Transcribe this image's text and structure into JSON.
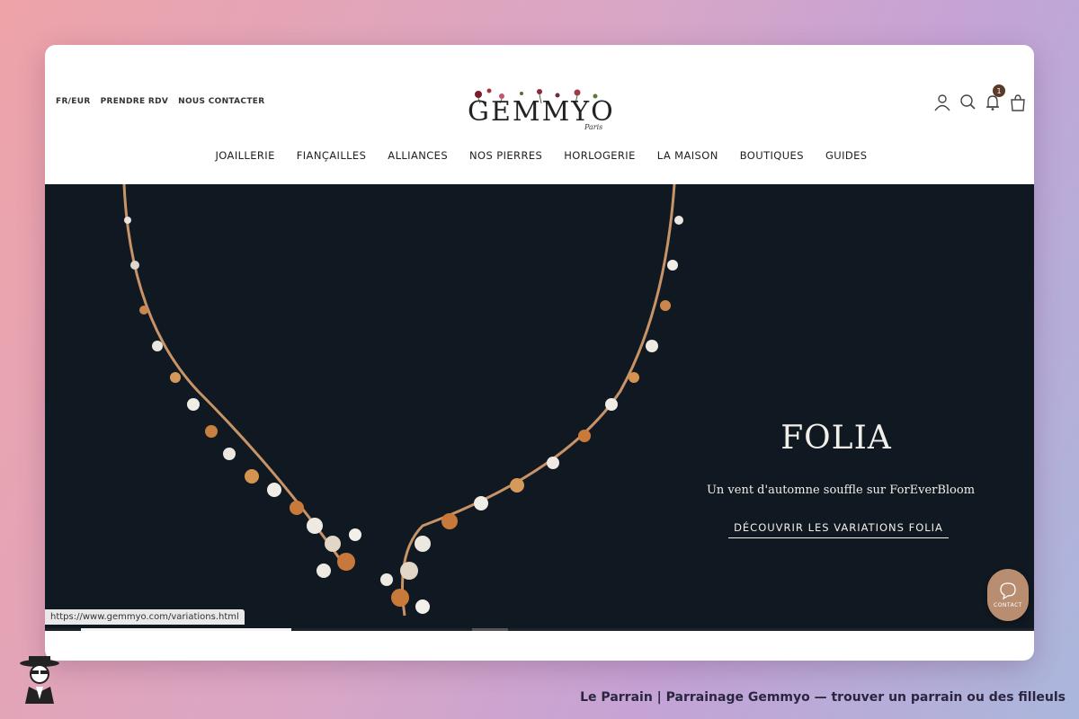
{
  "header": {
    "utility_links": [
      "FR/EUR",
      "PRENDRE RDV",
      "NOUS CONTACTER"
    ],
    "logo_text": "GEMMYO",
    "logo_sub": "Paris",
    "cart_badge": "1",
    "icons": [
      "user-icon",
      "search-icon",
      "bell-icon",
      "bag-icon"
    ]
  },
  "nav": {
    "items": [
      "JOAILLERIE",
      "FIANÇAILLES",
      "ALLIANCES",
      "NOS PIERRES",
      "HORLOGERIE",
      "LA MAISON",
      "BOUTIQUES",
      "GUIDES"
    ]
  },
  "hero": {
    "title": "FOLIA",
    "subtitle": "Un vent d'automne souffle sur ForEverBloom",
    "cta": "DÉCOUVRIR LES VARIATIONS FOLIA"
  },
  "contact": {
    "label": "CONTACT"
  },
  "status": {
    "url": "https://www.gemmyo.com/variations.html"
  },
  "caption": {
    "text": "Le Parrain | Parrainage Gemmyo — trouver un parrain ou des filleuls"
  },
  "colors": {
    "hero_bg": "#101821",
    "accent": "#b88d70",
    "badge": "#5a3a28"
  }
}
